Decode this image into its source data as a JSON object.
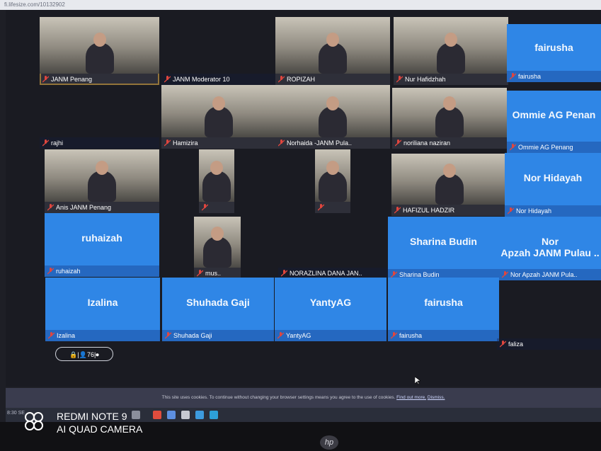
{
  "browser": {
    "url": "fi.lifesize.com/10132902"
  },
  "tiles": [
    {
      "name": "JANM Penang",
      "label": "",
      "style": "video",
      "selected": true
    },
    {
      "name": "JANM Moderator 10",
      "label": "",
      "style": "dark"
    },
    {
      "name": "ROPIZAH",
      "label": "",
      "style": "video"
    },
    {
      "name": "Nur Hafidzhah",
      "label": "",
      "style": "video"
    },
    {
      "name": "fairusha",
      "label": "fairusha",
      "style": "blue"
    },
    {
      "name": "rajhi",
      "label": "",
      "style": "dark"
    },
    {
      "name": "Hamizira",
      "label": "",
      "style": "video"
    },
    {
      "name": "Norhaida -JANM Pula..",
      "label": "",
      "style": "video"
    },
    {
      "name": "noriliana naziran",
      "label": "",
      "style": "video"
    },
    {
      "name": "Ommie AG Penang",
      "label": "Ommie AG Penan",
      "style": "blue"
    },
    {
      "name": "Anis JANM Penang",
      "label": "",
      "style": "video"
    },
    {
      "name": "",
      "label": "",
      "style": "video"
    },
    {
      "name": "",
      "label": "",
      "style": "video"
    },
    {
      "name": "HAFIZUL HADZIR",
      "label": "",
      "style": "video"
    },
    {
      "name": "Nor Hidayah",
      "label": "Nor Hidayah",
      "style": "blue"
    },
    {
      "name": "ruhaizah",
      "label": "ruhaizah",
      "style": "blue"
    },
    {
      "name": "mus..",
      "label": "",
      "style": "video"
    },
    {
      "name": "NORAZLINA DANA JAN..",
      "label": "",
      "style": "dark"
    },
    {
      "name": "Sharina Budin",
      "label": "Sharina Budin",
      "style": "blue"
    },
    {
      "name": "Nor Apzah JANM Pula..",
      "label": "Nor\nApzah JANM Pulau ..",
      "style": "blue"
    },
    {
      "name": "Izalina",
      "label": "Izalina",
      "style": "blue"
    },
    {
      "name": "Shuhada Gaji",
      "label": "Shuhada Gaji",
      "style": "blue"
    },
    {
      "name": "YantyAG",
      "label": "YantyAG",
      "style": "blue"
    },
    {
      "name": "fairusha",
      "label": "fairusha",
      "style": "blue"
    },
    {
      "name": "faliza",
      "label": "",
      "style": "dark"
    }
  ],
  "status": {
    "participants": "76",
    "text": "🔒|👤76|⏺"
  },
  "cookie_banner": {
    "text": "This site uses cookies. To continue without changing your browser settings means you agree to the use of cookies.",
    "find_out_more": "Find out more.",
    "dismiss": "Dismiss."
  },
  "taskbar": {
    "time": "8:30 SE"
  },
  "camera_watermark": {
    "line1": "REDMI NOTE 9",
    "line2": "AI QUAD CAMERA"
  },
  "hp_logo": "hp",
  "colors": {
    "tile_blue": "#2f86e6",
    "selected_border": "#d8a33a",
    "mic_red": "#e0463e"
  }
}
